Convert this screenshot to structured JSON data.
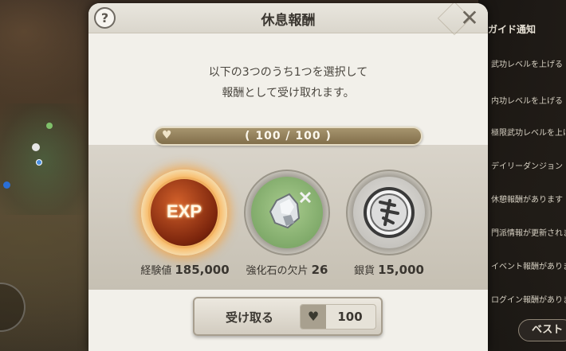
{
  "background": {
    "guide_panel": {
      "title": "ガイド通知",
      "items": [
        "武功レベルを上げる",
        "内功レベルを上げる",
        "極限武功レベルを上げる",
        "デイリーダンジョン",
        "休憩報酬があります",
        "門派情報が更新されました",
        "イベント報酬があります",
        "ログイン報酬があります"
      ],
      "best_button": "ベスト"
    }
  },
  "dialog": {
    "title": "休息報酬",
    "help_icon": "?",
    "close_icon": "✕",
    "message_line1": "以下の3つのうち1つを選択して",
    "message_line2": "報酬として受け取れます。",
    "fatigue": {
      "icon": "heart-icon",
      "current": 100,
      "max": 100,
      "text": "( 100 / 100 )"
    },
    "rewards": [
      {
        "name": "経験値",
        "amount": "185,000",
        "icon": "exp-icon",
        "icon_text": "EXP",
        "selected": true
      },
      {
        "name": "強化石の欠片",
        "amount": "26",
        "icon": "enhance-stone-icon",
        "selected": false
      },
      {
        "name": "銀貨",
        "amount": "15,000",
        "icon": "silver-coin-icon",
        "selected": false
      }
    ],
    "collect_button": {
      "label": "受け取る",
      "cost": "100",
      "cost_icon": "heart-icon"
    }
  },
  "colors": {
    "dialog_bg": "#f2f0ea",
    "fatigue_bar": "#9a8660",
    "exp_glow": "#f5a544",
    "stone_bg": "#8fb37a",
    "coin_bg": "#c8c6c2"
  }
}
